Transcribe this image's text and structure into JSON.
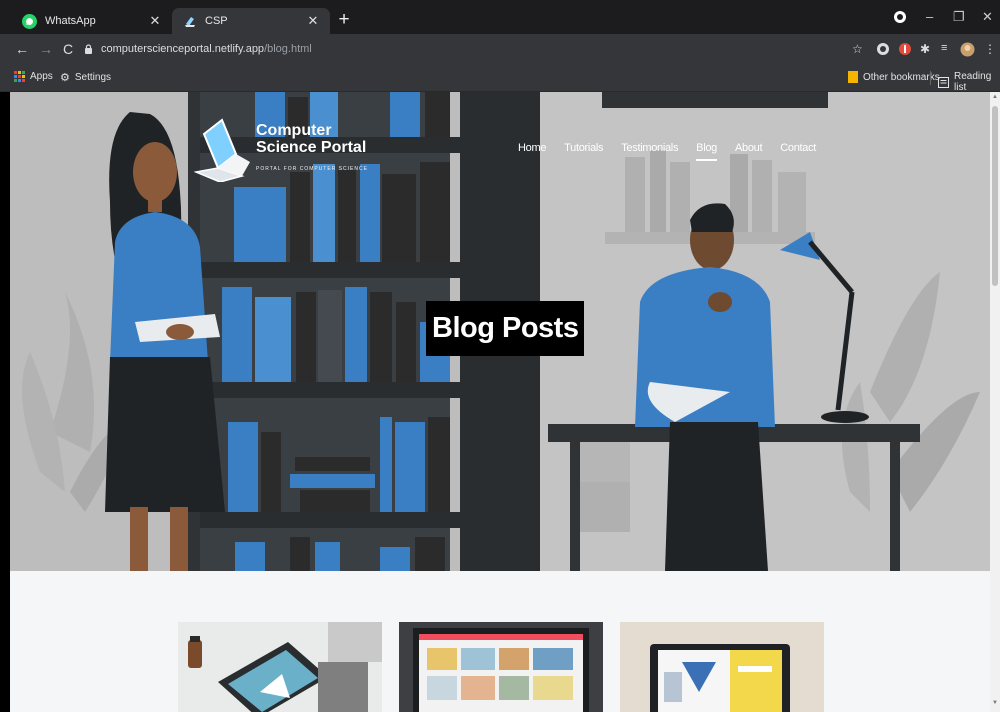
{
  "browser": {
    "tabs": [
      {
        "title": "WhatsApp",
        "active": false
      },
      {
        "title": "CSP",
        "active": true
      }
    ],
    "new_tab_symbol": "+",
    "url": {
      "host": "computerscienceportal.netlify.app",
      "path": "/blog.html"
    },
    "bookmarks": [
      {
        "label": "Apps",
        "icon": "apps-grid-icon"
      },
      {
        "label": "Settings",
        "icon": "gear-icon"
      }
    ],
    "bookmarks_right": [
      {
        "label": "Other bookmarks",
        "icon": "folder-icon"
      },
      {
        "label": "Reading list",
        "icon": "reading-list-icon"
      }
    ],
    "window_controls": {
      "minimize": "–",
      "restore": "❐",
      "close": "✕"
    }
  },
  "site": {
    "brand": {
      "line1": "Computer",
      "line2": "Science Portal",
      "tagline": "PORTAL FOR COMPUTER SCIENCE"
    },
    "nav": [
      {
        "label": "Home",
        "active": false
      },
      {
        "label": "Tutorials",
        "active": false
      },
      {
        "label": "Testimonials",
        "active": false
      },
      {
        "label": "Blog",
        "active": true
      },
      {
        "label": "About",
        "active": false
      },
      {
        "label": "Contact",
        "active": false
      }
    ],
    "hero_title": "Blog Posts"
  },
  "colors": {
    "accent_blue": "#3a7fc4",
    "dark": "#2f3336",
    "hero_bg": "#bdbdbd",
    "chrome_dark": "#1c1c1e",
    "chrome_toolbar": "#35363a"
  }
}
